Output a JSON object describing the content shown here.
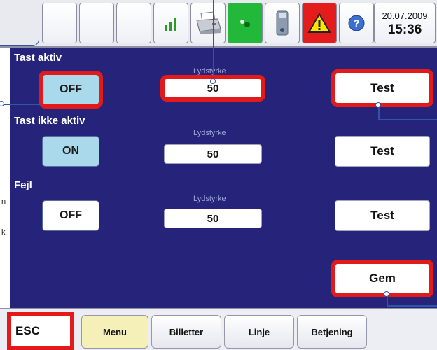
{
  "header": {
    "date": "20.07.2009",
    "time": "15:36",
    "icons": [
      "signal-icon",
      "printer-icon",
      "green-device-icon",
      "battery-icon",
      "warning-icon",
      "help-icon"
    ]
  },
  "sections": [
    {
      "label": "Tast aktiv",
      "toggle": "OFF",
      "volume_label": "Lydstyrke",
      "volume": "50",
      "test": "Test"
    },
    {
      "label": "Tast ikke aktiv",
      "toggle": "ON",
      "volume_label": "Lydstyrke",
      "volume": "50",
      "test": "Test"
    },
    {
      "label": "Fejl",
      "toggle": "OFF",
      "volume_label": "Lydstyrke",
      "volume": "50",
      "test": "Test"
    }
  ],
  "save_label": "Gem",
  "bottom": {
    "esc": "ESC",
    "menu": "Menu",
    "tickets": "Billetter",
    "line": "Linje",
    "operation": "Betjening"
  },
  "edge_chars": [
    "n",
    "k"
  ],
  "colors": {
    "panel": "#25247a",
    "highlight": "#e21a1a",
    "callout": "#2d56a6",
    "toggle_on": "#a9d9ea",
    "menu_button": "#f4f0b8"
  }
}
